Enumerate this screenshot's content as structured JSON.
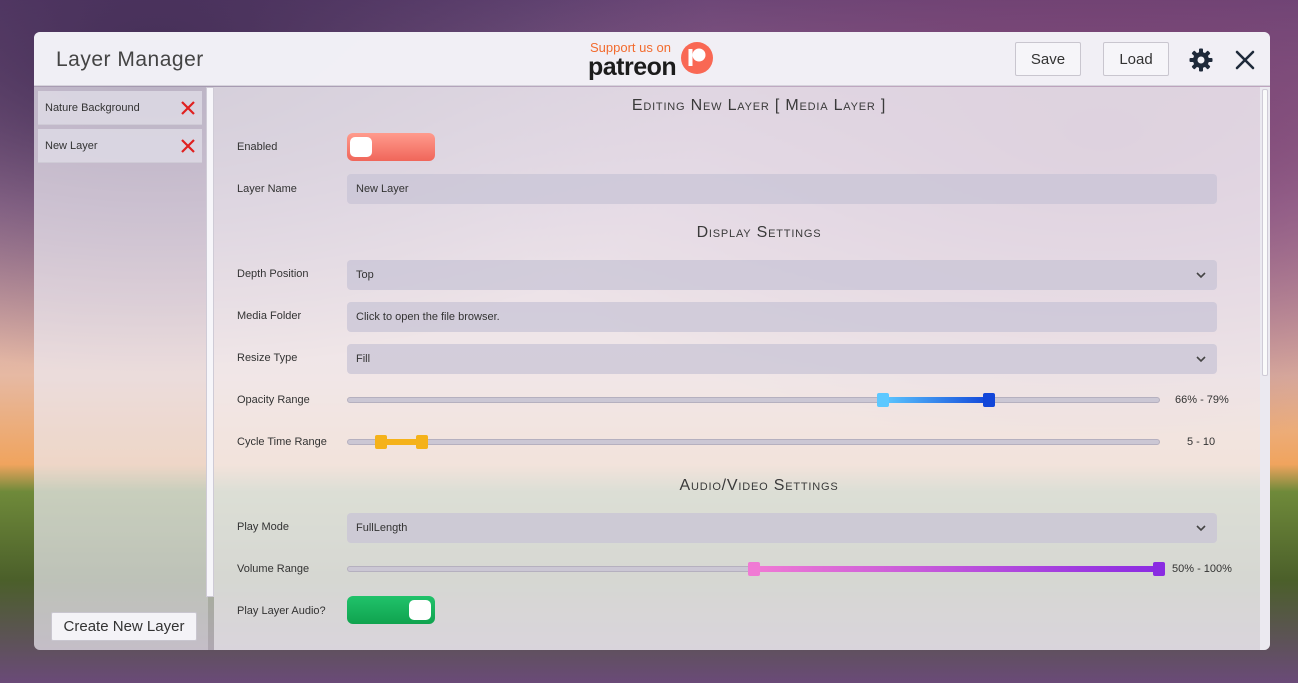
{
  "window": {
    "title": "Layer Manager"
  },
  "patreon": {
    "support_text": "Support us on",
    "word": "patreon"
  },
  "toolbar": {
    "save_label": "Save",
    "load_label": "Load",
    "settings_icon": "gear-icon",
    "close_icon": "close-icon"
  },
  "sidebar": {
    "layers": [
      {
        "label": "Nature Background"
      },
      {
        "label": "New Layer"
      }
    ],
    "create_label": "Create New Layer"
  },
  "editor": {
    "heading": "Editing New Layer [ Media Layer ]",
    "enabled": {
      "label": "Enabled",
      "value": false
    },
    "layer_name": {
      "label": "Layer Name",
      "value": "New Layer"
    },
    "display_heading": "Display Settings",
    "depth_position": {
      "label": "Depth Position",
      "value": "Top"
    },
    "media_folder": {
      "label": "Media Folder",
      "value": "Click to open the file browser."
    },
    "resize_type": {
      "label": "Resize Type",
      "value": "Fill"
    },
    "opacity_range": {
      "label": "Opacity Range",
      "min": 66,
      "max": 79,
      "text": "66% - 79%"
    },
    "cycle_time_range": {
      "label": "Cycle Time Range",
      "min": 5,
      "max": 10,
      "text": "5 - 10"
    },
    "av_heading": "Audio/Video Settings",
    "play_mode": {
      "label": "Play Mode",
      "value": "FullLength"
    },
    "volume_range": {
      "label": "Volume Range",
      "min": 50,
      "max": 100,
      "text": "50% - 100%"
    },
    "play_audio": {
      "label": "Play Layer Audio?",
      "value": true
    }
  },
  "colors": {
    "toggle_off": "#f0665a",
    "toggle_on": "#10a34f",
    "opacity_low": "#5cc8ff",
    "opacity_high": "#1246d9",
    "cycle": "#f5b21a",
    "volume_low": "#f07ad4",
    "volume_high": "#8a2be2",
    "delete": "#e02020",
    "patreon": "#f96854"
  }
}
